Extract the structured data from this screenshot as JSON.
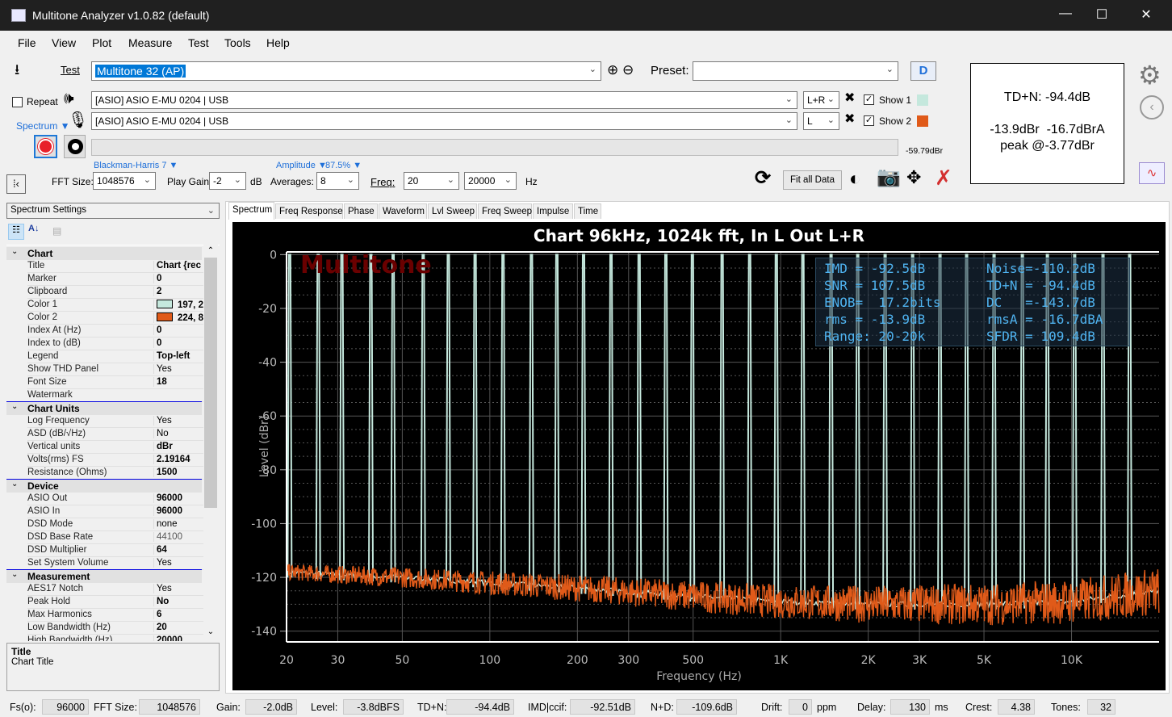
{
  "window": {
    "title": "Multitone Analyzer v1.0.82 (default)",
    "minimize": "—",
    "maximize": "☐",
    "close": "✕"
  },
  "menu": [
    "File",
    "View",
    "Plot",
    "Measure",
    "Test",
    "Tools",
    "Help"
  ],
  "toolbar": {
    "test_label": "Test",
    "test_value": "Multitone 32 (AP)",
    "preset_label": "Preset:",
    "preset_value": "",
    "repeat_label": "Repeat",
    "repeat_checked": false,
    "output_device": "[ASIO] ASIO E-MU 0204 | USB",
    "output_channel": "L+R",
    "input_device": "[ASIO] ASIO E-MU 0204 | USB",
    "input_channel": "L",
    "show1_label": "Show 1",
    "show1_checked": true,
    "show2_label": "Show 2",
    "show2_checked": true,
    "color1": "#c5e8dd",
    "color2": "#e05a19",
    "mode_label": "Spectrum ▼",
    "level_readout": "-59.79dBr",
    "level_progress": 0,
    "window_label": "Blackman-Harris 7 ▼",
    "amplitude_label": "Amplitude ▼",
    "overlap_label": "87.5% ▼",
    "fft_label": "FFT Size:",
    "fft_value": "1048576",
    "gain_label": "Play Gain:",
    "gain_value": "-2",
    "gain_unit": "dB",
    "avg_label": "Averages:",
    "avg_value": "8",
    "freq_label": "Freq:",
    "freq_from": "20",
    "freq_to": "20000",
    "freq_unit": "Hz",
    "fit_label": "Fit all Data"
  },
  "summary": {
    "tdn": "TD+N: -94.4dB",
    "levels": "-13.9dBr  -16.7dBrA",
    "peak": "peak @-3.77dBr"
  },
  "left_panel": {
    "selector": "Spectrum Settings",
    "categories": [
      {
        "name": "Chart",
        "items": [
          {
            "label": "Title",
            "value": "Chart {rec",
            "bold": true
          },
          {
            "label": "Marker",
            "value": "0",
            "bold": true
          },
          {
            "label": "Clipboard",
            "value": "2",
            "bold": true
          },
          {
            "label": "Color 1",
            "value": "197, 2",
            "bold": true,
            "swatch": "#c5e8dd"
          },
          {
            "label": "Color 2",
            "value": "224, 8",
            "bold": true,
            "swatch": "#e05a19"
          },
          {
            "label": "Index At (Hz)",
            "value": "0",
            "bold": true
          },
          {
            "label": "Index to (dB)",
            "value": "0",
            "bold": true
          },
          {
            "label": "Legend",
            "value": "Top-left",
            "bold": true
          },
          {
            "label": "Show THD Panel",
            "value": "Yes",
            "bold": false
          },
          {
            "label": "Font Size",
            "value": "18",
            "bold": true
          },
          {
            "label": "Watermark",
            "value": "",
            "bold": false
          }
        ]
      },
      {
        "name": "Chart Units",
        "items": [
          {
            "label": "Log Frequency",
            "value": "Yes",
            "bold": false
          },
          {
            "label": "ASD (dB/√Hz)",
            "value": "No",
            "bold": false
          },
          {
            "label": "Vertical units",
            "value": "dBr",
            "bold": true
          },
          {
            "label": "Volts(rms) FS",
            "value": "2.19164",
            "bold": true
          },
          {
            "label": "Resistance (Ohms)",
            "value": "1500",
            "bold": true
          }
        ]
      },
      {
        "name": "Device",
        "items": [
          {
            "label": "ASIO Out",
            "value": "96000",
            "bold": true
          },
          {
            "label": "ASIO In",
            "value": "96000",
            "bold": true
          },
          {
            "label": "DSD Mode",
            "value": "none",
            "bold": false
          },
          {
            "label": "DSD Base Rate",
            "value": "44100",
            "bold": false
          },
          {
            "label": "DSD Multiplier",
            "value": "64",
            "bold": true
          },
          {
            "label": "Set System Volume",
            "value": "Yes",
            "bold": false
          }
        ]
      },
      {
        "name": "Measurement",
        "items": [
          {
            "label": "AES17 Notch",
            "value": "Yes",
            "bold": false
          },
          {
            "label": "Peak Hold",
            "value": "No",
            "bold": true
          },
          {
            "label": "Max Harmonics",
            "value": "6",
            "bold": true
          },
          {
            "label": "Low Bandwidth (Hz)",
            "value": "20",
            "bold": true
          },
          {
            "label": "High Bandwidth (Hz)",
            "value": "20000",
            "bold": true
          }
        ]
      }
    ],
    "help_title": "Title",
    "help_text": "Chart Title"
  },
  "tabs": [
    {
      "label": "Spectrum",
      "active": true
    },
    {
      "label": "Freq Response"
    },
    {
      "label": "Phase"
    },
    {
      "label": "Waveform"
    },
    {
      "label": "Lvl Sweep"
    },
    {
      "label": "Freq Sweep"
    },
    {
      "label": "Impulse"
    },
    {
      "label": "Time"
    }
  ],
  "chart_data": {
    "type": "line",
    "title": "Chart 96kHz, 1024k fft, In L  Out L+R",
    "watermark": "Multitone",
    "xlabel": "Frequency (Hz)",
    "ylabel": "Level (dBr)",
    "xscale": "log",
    "xlim": [
      20,
      20000
    ],
    "ylim": [
      -144,
      1
    ],
    "xticks": [
      20,
      30,
      50,
      100,
      200,
      300,
      500,
      1000,
      2000,
      3000,
      5000,
      10000
    ],
    "xtick_labels": [
      "20",
      "30",
      "50",
      "100",
      "200",
      "300",
      "500",
      "1K",
      "2K",
      "3K",
      "5K",
      "10K"
    ],
    "yticks": [
      0,
      -20,
      -40,
      -60,
      -80,
      -100,
      -120,
      -140
    ],
    "ytick_labels": [
      "0",
      "-20",
      "-40",
      "-60",
      "-80",
      "-100",
      "-120",
      "-140"
    ],
    "grid": true,
    "series": [
      {
        "channel": 1,
        "color": "#c5e8dd",
        "tone_level_dB": 0,
        "tone_freqs_hz": [
          20.5,
          25.7,
          31,
          39,
          46.5,
          59,
          72,
          89,
          111,
          139,
          170,
          210,
          261,
          326,
          403,
          497,
          629,
          782,
          966,
          1192,
          1490,
          1840,
          2286,
          2842,
          3530,
          4358,
          5416,
          6776,
          8260,
          10250,
          12830,
          15840
        ]
      },
      {
        "channel": 2,
        "color": "#e05a19",
        "noise_floor": [
          [
            20,
            -118
          ],
          [
            30,
            -119
          ],
          [
            50,
            -120
          ],
          [
            100,
            -122
          ],
          [
            200,
            -124
          ],
          [
            500,
            -127
          ],
          [
            1000,
            -129
          ],
          [
            2000,
            -130
          ],
          [
            5000,
            -130
          ],
          [
            10000,
            -129
          ],
          [
            20000,
            -125
          ]
        ]
      }
    ],
    "stats": [
      [
        "IMD = -92.5dB",
        "Noise=-110.2dB"
      ],
      [
        "SNR = 107.5dB",
        "TD+N = -94.4dB"
      ],
      [
        "ENOB=  17.2bits",
        "DC   =-143.7dB"
      ],
      [
        "rms = -13.9dB",
        "rmsA = -16.7dBA"
      ],
      [
        "Range: 20-20k",
        "SFDR = 109.4dB"
      ]
    ]
  },
  "status": [
    {
      "label": "Fs(o):",
      "value": "96000"
    },
    {
      "label": "FFT Size:",
      "value": "1048576"
    },
    {
      "label": "Gain:",
      "value": "-2.0dB"
    },
    {
      "label": "Level:",
      "value": "-3.8dBFS"
    },
    {
      "label": "TD+N:",
      "value": "-94.4dB"
    },
    {
      "label": "IMD|ccif:",
      "value": "-92.51dB"
    },
    {
      "label": "N+D:",
      "value": "-109.6dB"
    },
    {
      "label": "Drift:",
      "value": "0",
      "unit": "ppm"
    },
    {
      "label": "Delay:",
      "value": "130",
      "unit": "ms"
    },
    {
      "label": "Crest:",
      "value": "4.38"
    },
    {
      "label": "Tones:",
      "value": "32"
    }
  ]
}
